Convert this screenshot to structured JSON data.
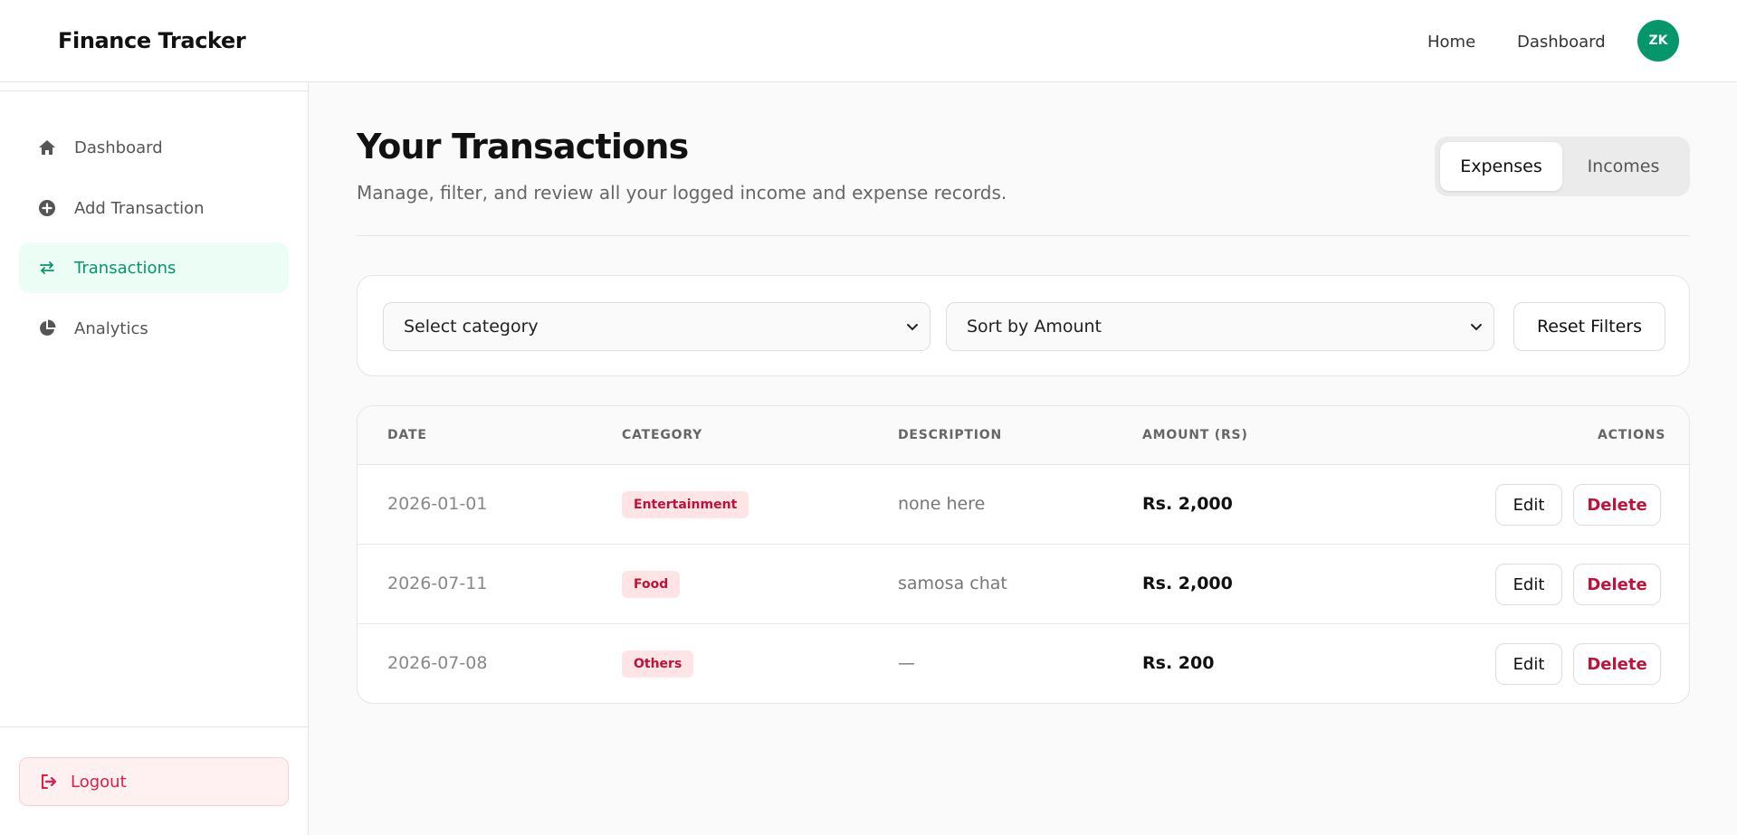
{
  "header": {
    "brand": "Finance Tracker",
    "nav": {
      "home": "Home",
      "dashboard": "Dashboard"
    },
    "avatar_initials": "ZK",
    "avatar_color": "#059669"
  },
  "sidebar": {
    "items": [
      {
        "label": "Dashboard",
        "icon": "home-icon",
        "active": false
      },
      {
        "label": "Add Transaction",
        "icon": "plus-circle-icon",
        "active": false
      },
      {
        "label": "Transactions",
        "icon": "swap-arrows-icon",
        "active": true
      },
      {
        "label": "Analytics",
        "icon": "pie-chart-icon",
        "active": false
      }
    ],
    "logout_label": "Logout"
  },
  "main": {
    "title": "Your Transactions",
    "subtitle": "Manage, filter, and review all your logged income and expense records.",
    "toggle": {
      "expenses": "Expenses",
      "incomes": "Incomes",
      "selected": "Expenses"
    }
  },
  "filters": {
    "category_select": "Select category",
    "sort_select": "Sort by Amount",
    "reset_label": "Reset Filters"
  },
  "table": {
    "headers": {
      "date": "DATE",
      "category": "CATEGORY",
      "description": "DESCRIPTION",
      "amount": "AMOUNT (RS)",
      "actions": "ACTIONS"
    },
    "edit_label": "Edit",
    "delete_label": "Delete",
    "rows": [
      {
        "date": "2026-01-01",
        "category": "Entertainment",
        "description": "none here",
        "amount": "Rs. 2,000"
      },
      {
        "date": "2026-07-11",
        "category": "Food",
        "description": "samosa chat",
        "amount": "Rs. 2,000"
      },
      {
        "date": "2026-07-08",
        "category": "Others",
        "description": "—",
        "amount": "Rs. 200"
      }
    ]
  },
  "colors": {
    "accent": "#059669",
    "accent_bg": "#ecfdf5",
    "danger": "#e11d48",
    "badge_bg": "#ffe4e6",
    "badge_text": "#be123c"
  }
}
